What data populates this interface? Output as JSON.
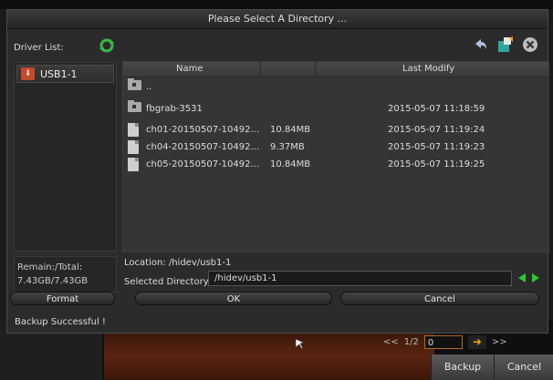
{
  "dialog": {
    "title": "Please Select A Directory ...",
    "driver_list_label": "Driver List:",
    "drives": [
      "USB1-1"
    ],
    "columns": {
      "name": "Name",
      "size": "",
      "last_modify": "Last Modify"
    },
    "files": [
      {
        "type": "folder",
        "name": "..",
        "size": "",
        "modified": ""
      },
      {
        "type": "folder",
        "name": "fbgrab-3531",
        "size": "",
        "modified": "2015-05-07 11:18:59"
      },
      {
        "type": "file",
        "name": "ch01-20150507-10492...",
        "size": "10.84MB",
        "modified": "2015-05-07 11:19:24"
      },
      {
        "type": "file",
        "name": "ch04-20150507-10492...",
        "size": "9.37MB",
        "modified": "2015-05-07 11:19:23"
      },
      {
        "type": "file",
        "name": "ch05-20150507-10492...",
        "size": "10.84MB",
        "modified": "2015-05-07 11:19:25"
      }
    ],
    "remain_label": "Remain:/Total:",
    "remain_value": "7.43GB/7.43GB",
    "location_text": "Location:  /hidev/usb1-1",
    "selected_dir_label": "Selected Directory:",
    "selected_dir_value": "/hidev/usb1-1",
    "format_label": "Format",
    "ok_label": "OK",
    "cancel_label": "Cancel",
    "status_text": "Backup Successful !"
  },
  "background": {
    "pager_prev": "<<",
    "pager_page": "1/2",
    "pager_input": "0",
    "pager_next": ">>",
    "backup_label": "Backup",
    "cancel_label": "Cancel"
  },
  "colors": {
    "accent_green": "#2fc82f",
    "accent_orange": "#f3a90e",
    "usb_red": "#c24a2a"
  },
  "icons": [
    "refresh-icon",
    "back-arrow-icon",
    "new-folder-icon",
    "close-icon",
    "usb-drive-icon",
    "folder-icon",
    "file-icon",
    "arrow-left-icon",
    "arrow-right-icon",
    "mouse-cursor-icon"
  ]
}
